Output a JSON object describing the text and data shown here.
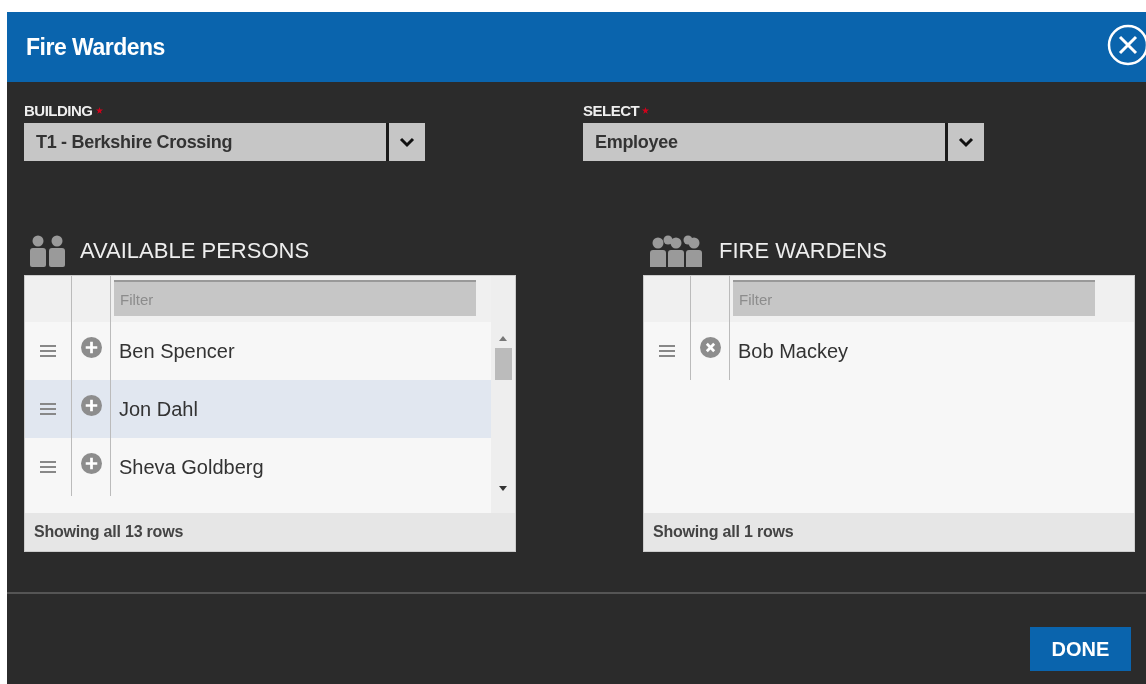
{
  "dialog": {
    "title": "Fire Wardens"
  },
  "fields": [
    {
      "label": "BUILDING",
      "required": true,
      "value": "T1 - Berkshire Crossing"
    },
    {
      "label": "SELECT",
      "required": true,
      "value": "Employee"
    }
  ],
  "lists": [
    {
      "heading": "AVAILABLE PERSONS",
      "kind": "available",
      "filter": {
        "placeholder": "Filter"
      },
      "scrollbar": true,
      "rows": [
        {
          "name": "Ben Spencer",
          "selected": false
        },
        {
          "name": "Jon Dahl",
          "selected": true
        },
        {
          "name": "Sheva Goldberg",
          "selected": false
        }
      ],
      "footer": "Showing all 13 rows"
    },
    {
      "heading": "FIRE WARDENS",
      "kind": "wardens",
      "filter": {
        "placeholder": "Filter"
      },
      "scrollbar": false,
      "rows": [
        {
          "name": "Bob Mackey",
          "selected": false
        }
      ],
      "footer": "Showing all 1 rows"
    }
  ],
  "buttons": [
    {
      "label": "DONE"
    }
  ]
}
